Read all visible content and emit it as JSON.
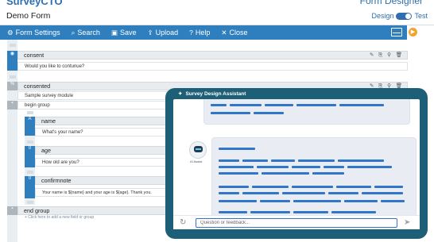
{
  "header": {
    "brand": "SurveyCTO",
    "app_name": "Form Designer",
    "form_title": "Demo Form",
    "mode_design": "Design",
    "mode_test": "Test"
  },
  "toolbar": {
    "form_settings": "Form Settings",
    "search": "Search",
    "save": "Save",
    "upload": "Upload",
    "help": "Help",
    "close": "Close",
    "icons": [
      "gear-icon",
      "magnifier-icon",
      "floppy-icon",
      "upload-icon",
      "question-icon",
      "x-icon",
      "panel-icon"
    ]
  },
  "questions": [
    {
      "name": "consent",
      "label": "Would you like to contunue?",
      "type_badge": "◉"
    },
    {
      "name": "consented",
      "label": "Sample survey module",
      "type_badge": "%"
    },
    {
      "name": "begin group",
      "label": "",
      "type_badge": "▪"
    },
    {
      "name": "name",
      "label": "What's your name?",
      "type_badge": "A"
    },
    {
      "name": "age",
      "label": "How old are you?",
      "type_badge": "0"
    },
    {
      "name": "confirmnote",
      "label": "Your name is ${name} and your age is ${age}. Thank you.",
      "type_badge": "0"
    },
    {
      "name": "end group",
      "label": "",
      "type_badge": "▪"
    }
  ],
  "add_link": "+ Click here to add a new field or group",
  "assistant": {
    "title": "Survey Design Assistant",
    "bot_name": "AI Assist",
    "input_placeholder": "Question or feedback..."
  },
  "colors": {
    "toolbar_blue": "#2f7fbf",
    "assistant_frame": "#1e5f78",
    "accent_orange": "#f0a432"
  }
}
